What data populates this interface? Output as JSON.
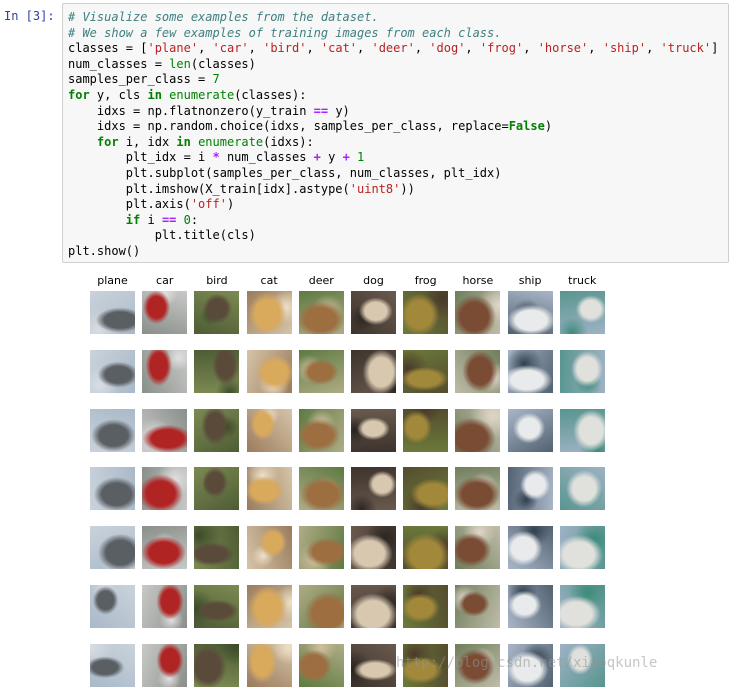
{
  "prompt": "In [3]:",
  "code_lines": [
    [
      [
        "cm",
        "# Visualize some examples from the dataset."
      ]
    ],
    [
      [
        "cm",
        "# We show a few examples of training images from each class."
      ]
    ],
    [
      [
        "",
        "classes = ["
      ],
      [
        "st",
        "'plane'"
      ],
      [
        "",
        ", "
      ],
      [
        "st",
        "'car'"
      ],
      [
        "",
        ", "
      ],
      [
        "st",
        "'bird'"
      ],
      [
        "",
        ", "
      ],
      [
        "st",
        "'cat'"
      ],
      [
        "",
        ", "
      ],
      [
        "st",
        "'deer'"
      ],
      [
        "",
        ", "
      ],
      [
        "st",
        "'dog'"
      ],
      [
        "",
        ", "
      ],
      [
        "st",
        "'frog'"
      ],
      [
        "",
        ", "
      ],
      [
        "st",
        "'horse'"
      ],
      [
        "",
        ", "
      ],
      [
        "st",
        "'ship'"
      ],
      [
        "",
        ", "
      ],
      [
        "st",
        "'truck'"
      ],
      [
        "",
        "]"
      ]
    ],
    [
      [
        "",
        "num_classes = "
      ],
      [
        "bi",
        "len"
      ],
      [
        "",
        "(classes)"
      ]
    ],
    [
      [
        "",
        "samples_per_class = "
      ],
      [
        "nu",
        "7"
      ]
    ],
    [
      [
        "kw",
        "for"
      ],
      [
        "",
        " y, cls "
      ],
      [
        "kw",
        "in"
      ],
      [
        "",
        " "
      ],
      [
        "bi",
        "enumerate"
      ],
      [
        "",
        "(classes):"
      ]
    ],
    [
      [
        "",
        "    idxs = np.flatnonzero(y_train "
      ],
      [
        "op",
        "=="
      ],
      [
        "",
        " y)"
      ]
    ],
    [
      [
        "",
        "    idxs = np.random.choice(idxs, samples_per_class, replace="
      ],
      [
        "kw",
        "False"
      ],
      [
        "",
        ")"
      ]
    ],
    [
      [
        "",
        "    "
      ],
      [
        "kw",
        "for"
      ],
      [
        "",
        " i, idx "
      ],
      [
        "kw",
        "in"
      ],
      [
        "",
        " "
      ],
      [
        "bi",
        "enumerate"
      ],
      [
        "",
        "(idxs):"
      ]
    ],
    [
      [
        "",
        "        plt_idx = i "
      ],
      [
        "op",
        "*"
      ],
      [
        "",
        " num_classes "
      ],
      [
        "op",
        "+"
      ],
      [
        "",
        " y "
      ],
      [
        "op",
        "+"
      ],
      [
        "",
        " "
      ],
      [
        "nu",
        "1"
      ]
    ],
    [
      [
        "",
        "        plt.subplot(samples_per_class, num_classes, plt_idx)"
      ]
    ],
    [
      [
        "",
        "        plt.imshow(X_train[idx].astype("
      ],
      [
        "st",
        "'uint8'"
      ],
      [
        "",
        "))"
      ]
    ],
    [
      [
        "",
        "        plt.axis("
      ],
      [
        "st",
        "'off'"
      ],
      [
        "",
        ")"
      ]
    ],
    [
      [
        "",
        "        "
      ],
      [
        "kw",
        "if"
      ],
      [
        "",
        " i "
      ],
      [
        "op",
        "=="
      ],
      [
        "",
        " "
      ],
      [
        "nu",
        "0"
      ],
      [
        "",
        ":"
      ]
    ],
    [
      [
        "",
        "            plt.title(cls)"
      ]
    ],
    [
      [
        "",
        "plt.show()"
      ]
    ]
  ],
  "classes": [
    "plane",
    "car",
    "bird",
    "cat",
    "deer",
    "dog",
    "frog",
    "horse",
    "ship",
    "truck"
  ],
  "samples_per_class": 7,
  "class_palettes": [
    {
      "bg": "#a9b9c9",
      "fg": "#5a5f63",
      "ac": "#d8dde2"
    },
    {
      "bg": "#8a8f8a",
      "fg": "#b02424",
      "ac": "#e0e0e0"
    },
    {
      "bg": "#7c8a52",
      "fg": "#5a4a3a",
      "ac": "#3c4a2a"
    },
    {
      "bg": "#9a7c5c",
      "fg": "#d9a95c",
      "ac": "#eee0c8"
    },
    {
      "bg": "#5e7a42",
      "fg": "#9c6e40",
      "ac": "#d0c0a0"
    },
    {
      "bg": "#6a5a4e",
      "fg": "#d8c8b0",
      "ac": "#2a2420"
    },
    {
      "bg": "#6c7a3a",
      "fg": "#a2883a",
      "ac": "#4a3a2a"
    },
    {
      "bg": "#6f7e5c",
      "fg": "#7a4c34",
      "ac": "#e0d6c8"
    },
    {
      "bg": "#a8b6c8",
      "fg": "#e8eaec",
      "ac": "#30404e"
    },
    {
      "bg": "#9eb2c4",
      "fg": "#e0e0dc",
      "ac": "#3c8a7a"
    }
  ],
  "watermark": "http://blog.csdn.net/xiaoqkunle"
}
